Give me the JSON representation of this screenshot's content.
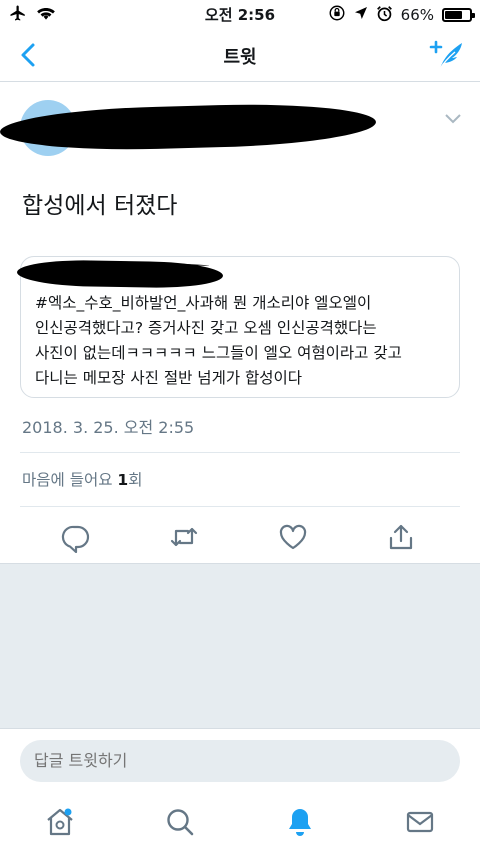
{
  "status_bar": {
    "time": "오전 2:56",
    "battery_percent": "66%",
    "battery_level": 0.66
  },
  "nav": {
    "title": "트윗"
  },
  "tweet": {
    "text": "합성에서 터졌다",
    "quote_text": "#엑소_수호_비하발언_사과해 뭔 개소리야 엘오엘이\n인신공격했다고? 증거사진 갖고 오셈 인신공격했다는\n사진이 없는데ㅋㅋㅋㅋㅋ 느그들이 엘오 여혐이라고 갖고\n다니는 메모장 사진 절반 넘게가 합성이다",
    "timestamp": "2018. 3. 25. 오전 2:55",
    "likes_prefix": "마음에 들어요 ",
    "likes_count": "1",
    "likes_suffix": "회"
  },
  "reply": {
    "placeholder": "답글 트윗하기"
  },
  "colors": {
    "accent": "#1da1f2",
    "icon_gray": "#657786",
    "background_gray": "#e6ecf0"
  },
  "icons": {
    "actions": [
      "reply-icon",
      "retweet-icon",
      "like-icon",
      "share-icon"
    ],
    "tabs": [
      "home-icon",
      "search-icon",
      "notifications-icon",
      "messages-icon"
    ]
  }
}
